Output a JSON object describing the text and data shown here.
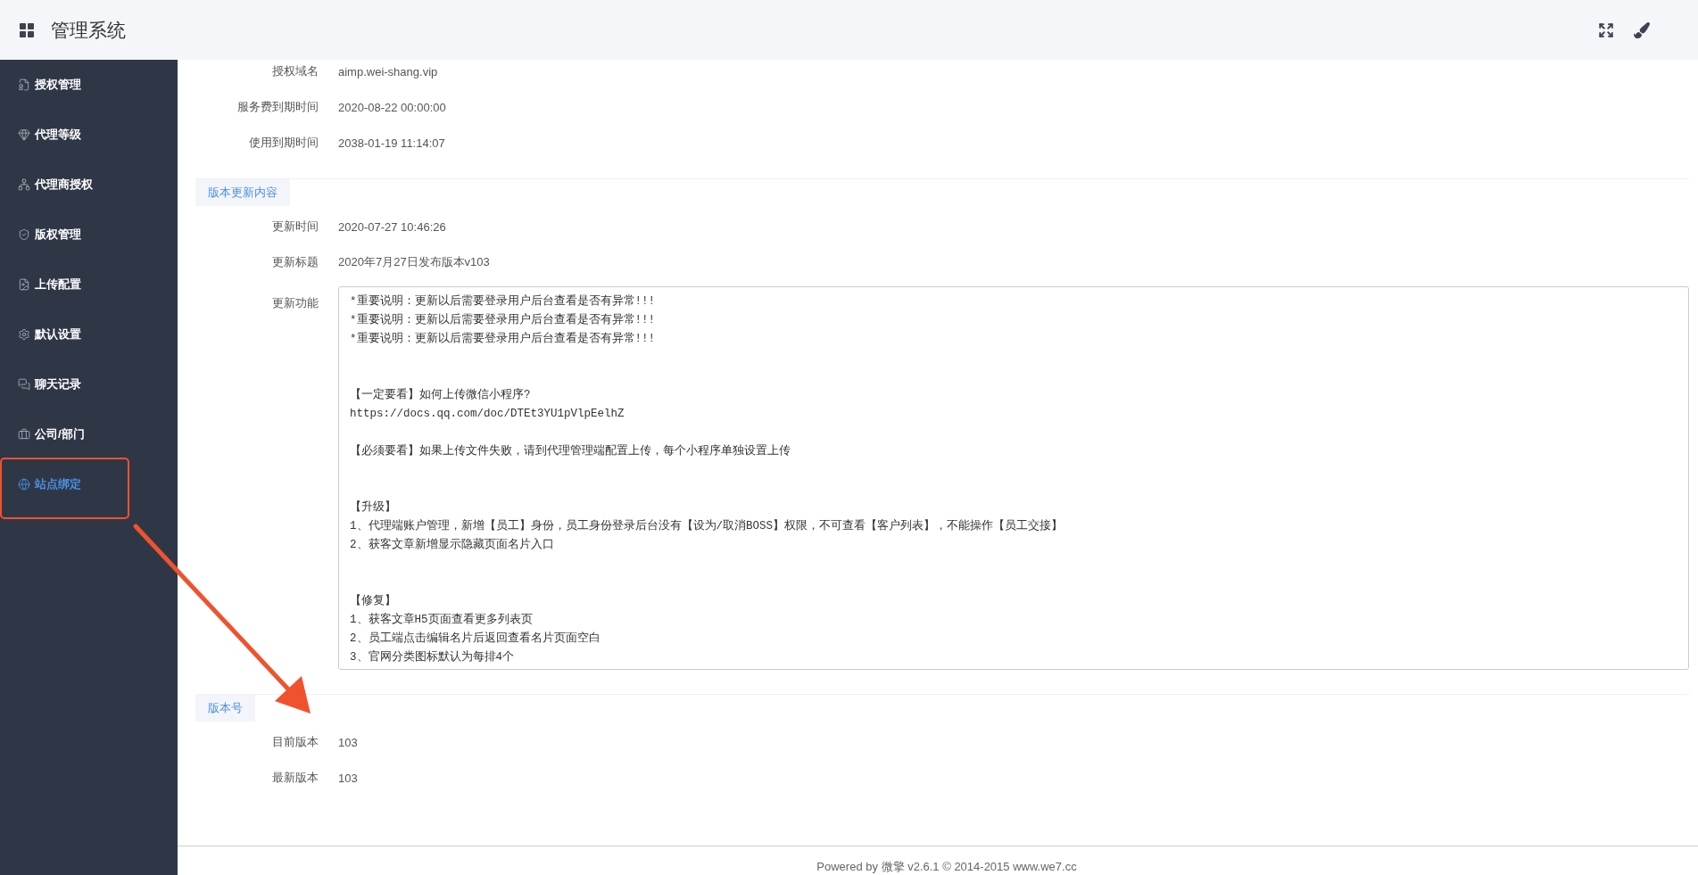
{
  "header": {
    "title": "管理系统"
  },
  "sidebar": {
    "items": [
      {
        "label": "授权管理",
        "selected": false,
        "highlighted": false
      },
      {
        "label": "代理等级",
        "selected": false,
        "highlighted": false
      },
      {
        "label": "代理商授权",
        "selected": false,
        "highlighted": false
      },
      {
        "label": "版权管理",
        "selected": false,
        "highlighted": false
      },
      {
        "label": "上传配置",
        "selected": false,
        "highlighted": false
      },
      {
        "label": "默认设置",
        "selected": false,
        "highlighted": false
      },
      {
        "label": "聊天记录",
        "selected": false,
        "highlighted": false
      },
      {
        "label": "公司/部门",
        "selected": false,
        "highlighted": false
      },
      {
        "label": "站点绑定",
        "selected": true,
        "highlighted": true
      }
    ]
  },
  "sections": [
    {
      "rows": [
        {
          "label": "授权域名",
          "value": "aimp.wei-shang.vip"
        },
        {
          "label": "服务费到期时间",
          "value": "2020-08-22 00:00:00"
        },
        {
          "label": "使用到期时间",
          "value": "2038-01-19 11:14:07"
        }
      ]
    },
    {
      "title": "版本更新内容",
      "rows": [
        {
          "label": "更新时间",
          "value": "2020-07-27 10:46:26"
        },
        {
          "label": "更新标题",
          "value": "2020年7月27日发布版本v103"
        },
        {
          "label": "更新功能",
          "kind": "textarea",
          "lines": [
            {
              "text": "*重要说明：更新以后需要登录用户后台查看是否有异常!!!",
              "kind": "line"
            },
            {
              "text": "*重要说明：更新以后需要登录用户后台查看是否有异常!!!",
              "kind": "line"
            },
            {
              "text": "*重要说明：更新以后需要登录用户后台查看是否有异常!!!",
              "kind": "line"
            },
            {
              "text": "【一定要看】如何上传微信小程序?",
              "kind": "wide"
            },
            {
              "text": "https://docs.qq.com/doc/DTEt3YU1pVlpEelhZ",
              "kind": "line"
            },
            {
              "text": "【必须要看】如果上传文件失败，请到代理管理端配置上传，每个小程序单独设置上传",
              "kind": "spaced"
            },
            {
              "text": "【升级】",
              "kind": "wide"
            },
            {
              "text": "1、代理端账户管理，新增【员工】身份，员工身份登录后台没有【设为/取消BOSS】权限，不可查看【客户列表】，不能操作【员工交接】",
              "kind": "line"
            },
            {
              "text": "2、获客文章新增显示隐藏页面名片入口",
              "kind": "line"
            },
            {
              "text": "【修复】",
              "kind": "wide"
            },
            {
              "text": "1、获客文章H5页面查看更多列表页",
              "kind": "line"
            },
            {
              "text": "2、员工端点击编辑名片后返回查看名片页面空白",
              "kind": "line"
            },
            {
              "text": "3、官网分类图标默认为每排4个",
              "kind": "line"
            }
          ]
        }
      ]
    },
    {
      "title": "版本号",
      "rows": [
        {
          "label": "目前版本",
          "value": "103"
        },
        {
          "label": "最新版本",
          "value": "103"
        }
      ]
    }
  ],
  "footer": {
    "text": "Powered by 微擎 v2.6.1 © 2014-2015 www.we7.cc"
  }
}
